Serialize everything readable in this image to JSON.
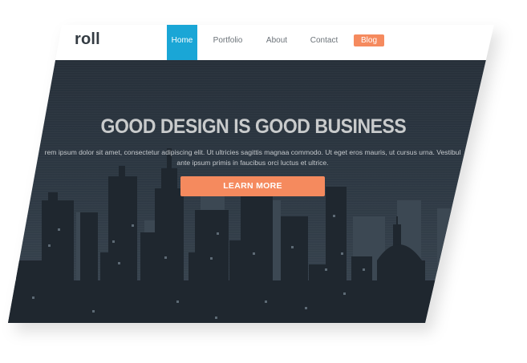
{
  "brand": {
    "logo_text": "roll"
  },
  "nav": {
    "home": "Home",
    "portfolio": "Portfolio",
    "about": "About",
    "contact": "Contact",
    "blog": "Blog"
  },
  "hero": {
    "headline": "GOOD DESIGN IS GOOD BUSINESS",
    "subtext_line1": "rem ipsum dolor sit amet, consectetur adipiscing elit. Ut ultricies sagittis magnaa commodo. Ut eget eros mauris, ut cursus urna. Vestibul",
    "subtext_line2": "ante ipsum primis in faucibus orci luctus et ultrice.",
    "cta_label": "LEARN MORE"
  },
  "colors": {
    "accent": "#f58a5e",
    "nav_active": "#1aa6d6",
    "hero_dark": "#27303a",
    "building": "#1f272f"
  }
}
